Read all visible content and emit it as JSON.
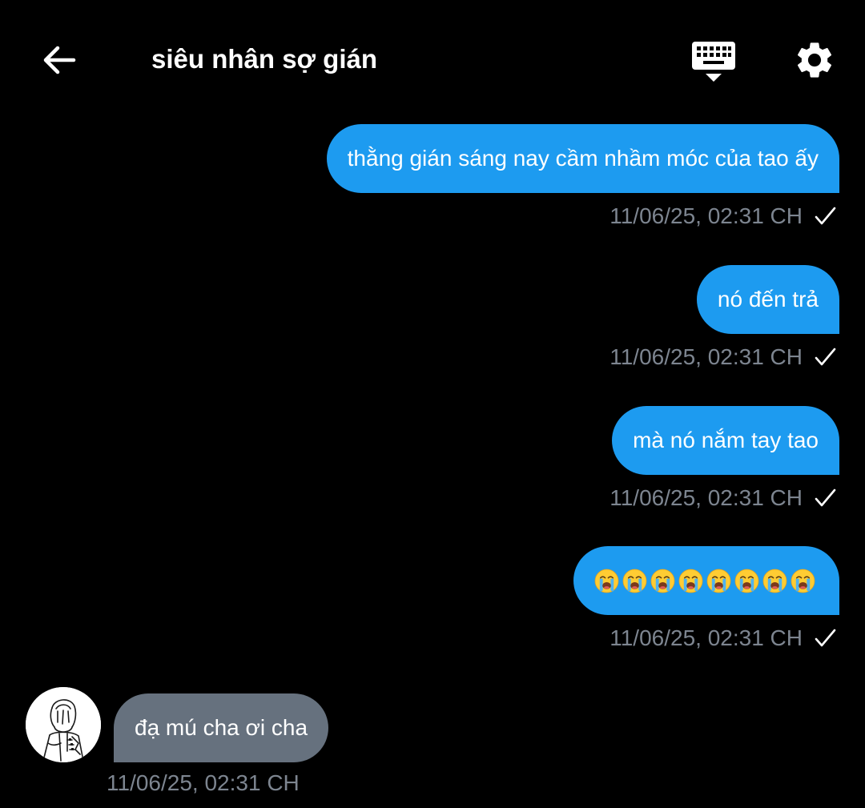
{
  "header": {
    "title": "siêu nhân sợ gián",
    "back_icon": "arrow-left-icon",
    "keyboard_icon": "keyboard-icon",
    "settings_icon": "gear-icon"
  },
  "colors": {
    "background": "#000000",
    "outgoing_bubble": "#1d9bf0",
    "incoming_bubble": "#66717e",
    "timestamp": "#7d8590",
    "text": "#ffffff"
  },
  "messages": [
    {
      "direction": "outgoing",
      "text": "thằng gián sáng nay cầm nhầm móc của tao ấy",
      "time": "11/06/25, 02:31 CH",
      "status_icon": "checkmark-icon"
    },
    {
      "direction": "outgoing",
      "text": "nó đến trả",
      "time": "11/06/25, 02:31 CH",
      "status_icon": "checkmark-icon"
    },
    {
      "direction": "outgoing",
      "text": "mà nó nắm tay tao",
      "time": "11/06/25, 02:31 CH",
      "status_icon": "checkmark-icon"
    },
    {
      "direction": "outgoing",
      "text": "😭😭😭😭😭😭😭😭",
      "emoji_name": "loudly-crying-face",
      "emoji_count": 8,
      "time": "11/06/25, 02:31 CH",
      "status_icon": "checkmark-icon"
    },
    {
      "direction": "incoming",
      "text": "đạ mú cha ơi cha",
      "time": "11/06/25, 02:31 CH",
      "avatar_icon": "avatar"
    }
  ]
}
